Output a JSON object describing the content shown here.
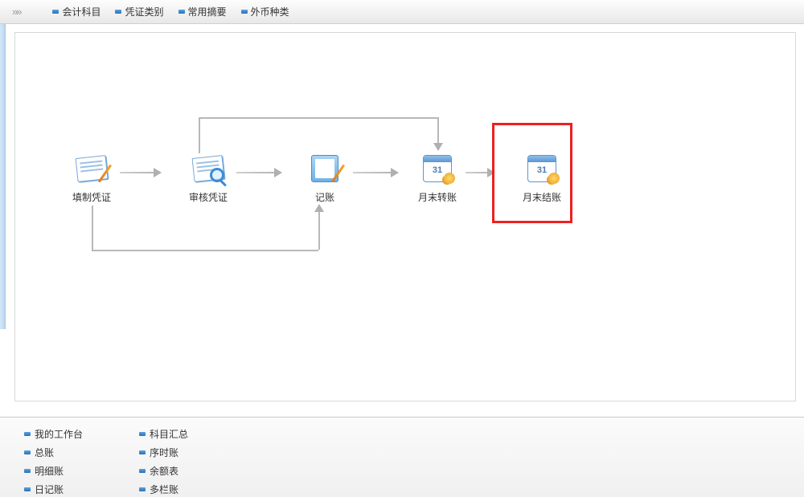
{
  "topbar": {
    "links": [
      "会计科目",
      "凭证类别",
      "常用摘要",
      "外币种类"
    ]
  },
  "flow": {
    "nodes": [
      {
        "id": "fill",
        "label": "填制凭证"
      },
      {
        "id": "audit",
        "label": "审核凭证"
      },
      {
        "id": "book",
        "label": "记账"
      },
      {
        "id": "transfer",
        "label": "月末转账"
      },
      {
        "id": "close",
        "label": "月末结账"
      }
    ]
  },
  "bottom": {
    "col1": [
      "我的工作台",
      "总账",
      "明细账",
      "日记账"
    ],
    "col2": [
      "科目汇总",
      "序时账",
      "余额表",
      "多栏账"
    ]
  }
}
